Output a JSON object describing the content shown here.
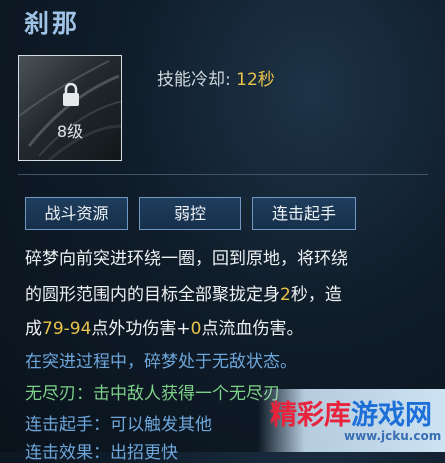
{
  "skill": {
    "name": "刹那",
    "level": "8级",
    "cooldown_label": "技能冷却:",
    "cooldown_value": "12秒"
  },
  "tags": [
    "战斗资源",
    "弱控",
    "连击起手"
  ],
  "description": {
    "p1_line1": "碎梦向前突进环绕一圈，回到原地，将环绕",
    "p1_line2a": "的圆形范围内的目标全部聚拢定身",
    "p1_line2_num": "2",
    "p1_line2b": "秒，造",
    "p1_line3a": "成",
    "p1_line3_num1": "79-94",
    "p1_line3b": "点外功伤害+",
    "p1_line3_num2": "0",
    "p1_line3c": "点流血伤害。",
    "invincible": "在突进过程中，碎梦处于无敌状态。",
    "endless": "无尽刃：击中敌人获得一个无尽刃",
    "combo_start": "连击起手：可以触发其他",
    "combo_effect": "连击效果：出招更快"
  },
  "watermark": {
    "text_red": "精彩库",
    "text_blue": "游戏网",
    "url": "www.jcku.com"
  },
  "colors": {
    "title": "#9fc3e6",
    "highlight": "#e9c34a",
    "blue_text": "#6ea6da",
    "green_text": "#7ed08a",
    "tag_border": "#6f98c2"
  }
}
